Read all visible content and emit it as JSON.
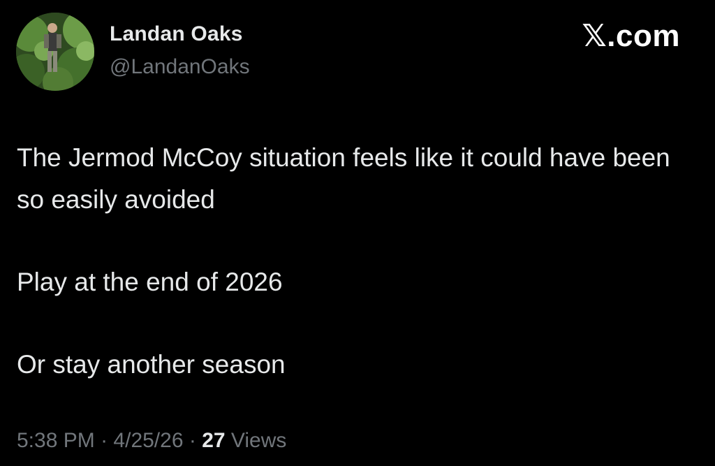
{
  "author": {
    "display_name": "Landan Oaks",
    "handle": "@LandanOaks",
    "avatar_icon": "profile-photo"
  },
  "brand": {
    "label": "𝕏.com"
  },
  "tweet": {
    "paragraphs": [
      "The Jermod McCoy situation feels like it could have been so easily avoided",
      "Play at the end of 2026",
      "Or stay another season"
    ]
  },
  "meta": {
    "time": "5:38 PM",
    "separator": "·",
    "date": "4/25/26",
    "views_count": "27",
    "views_label": "Views"
  },
  "colors": {
    "background": "#000000",
    "primary_text": "#e7e9ea",
    "secondary_text": "#71767b"
  }
}
